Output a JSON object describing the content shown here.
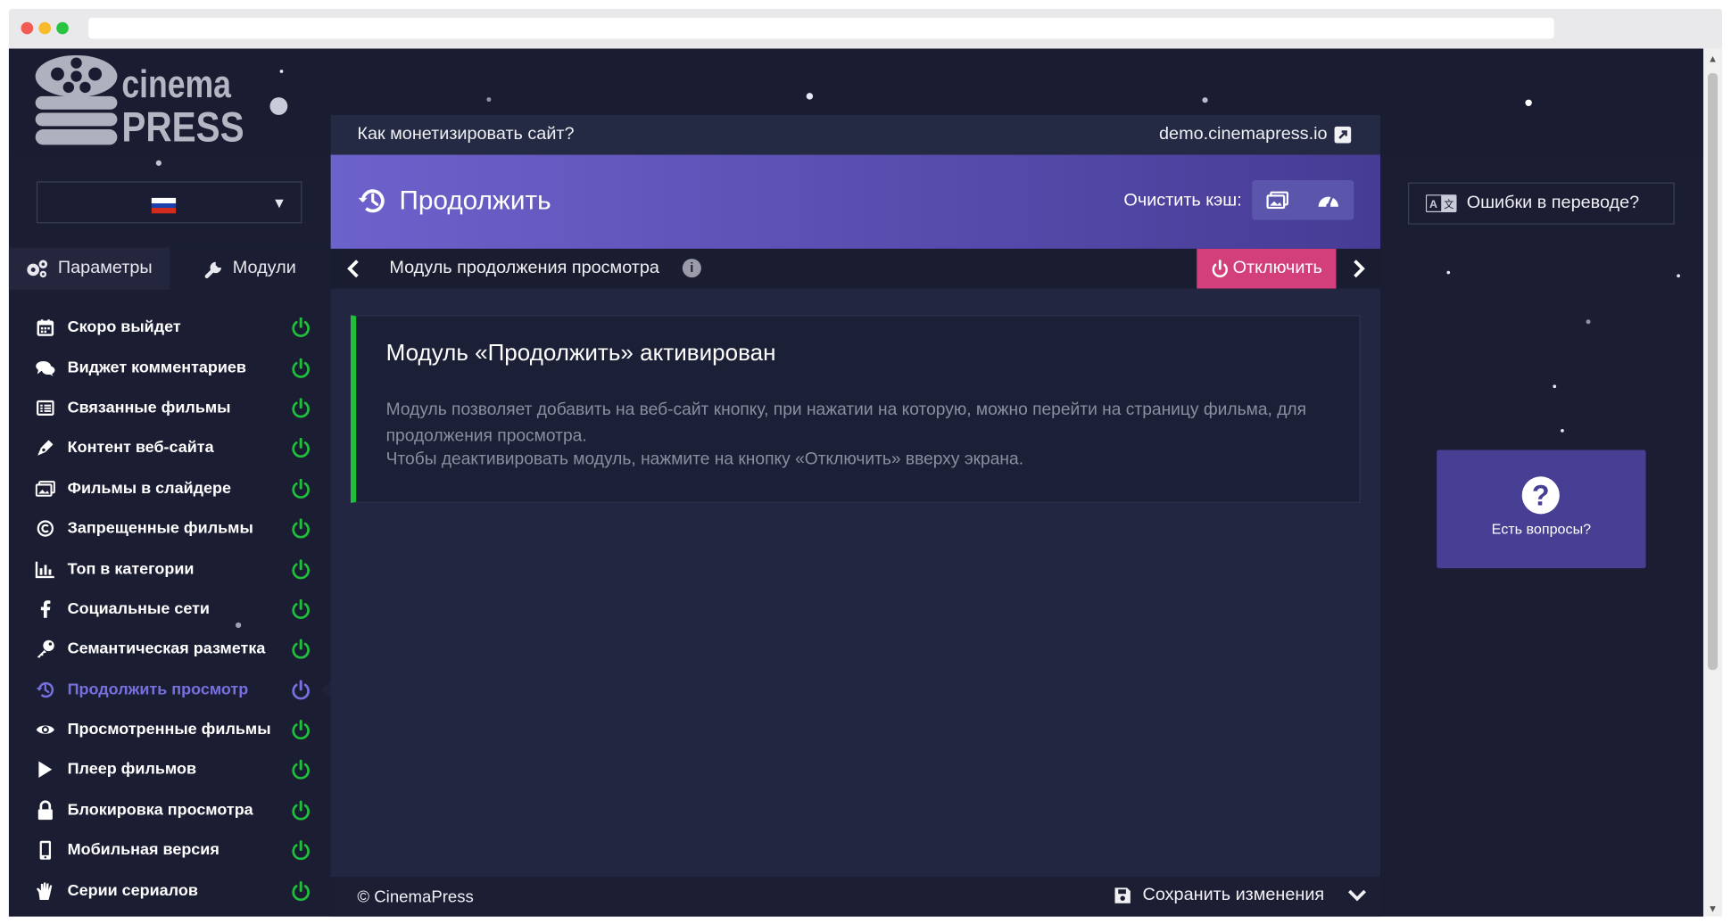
{
  "brand": {
    "line1": "cinema",
    "line2": "PRESS"
  },
  "language": {
    "flag": "ru-flag",
    "colors": [
      "#ffffff",
      "#1c3fae",
      "#d52b1e"
    ]
  },
  "tabs": {
    "params": "Параметры",
    "modules": "Модули"
  },
  "menu": [
    {
      "label": "Скоро выйдет",
      "icon": "calendar-icon"
    },
    {
      "label": "Виджет комментариев",
      "icon": "comments-icon"
    },
    {
      "label": "Связанные фильмы",
      "icon": "list-icon"
    },
    {
      "label": "Контент веб-сайта",
      "icon": "pen-icon"
    },
    {
      "label": "Фильмы в слайдере",
      "icon": "images-icon"
    },
    {
      "label": "Запрещенные фильмы",
      "icon": "copyright-icon"
    },
    {
      "label": "Топ в категории",
      "icon": "chart-icon"
    },
    {
      "label": "Социальные сети",
      "icon": "facebook-icon"
    },
    {
      "label": "Семантическая разметка",
      "icon": "key-icon"
    },
    {
      "label": "Продолжить просмотр",
      "icon": "history-icon",
      "active": true
    },
    {
      "label": "Просмотренные фильмы",
      "icon": "eye-icon"
    },
    {
      "label": "Плеер фильмов",
      "icon": "play-icon"
    },
    {
      "label": "Блокировка просмотра",
      "icon": "lock-icon"
    },
    {
      "label": "Мобильная версия",
      "icon": "mobile-icon"
    },
    {
      "label": "Серии сериалов",
      "icon": "hand-icon"
    }
  ],
  "topbar": {
    "monetize": "Как монетизировать сайт?",
    "site": "demo.cinemapress.io"
  },
  "header": {
    "title": "Продолжить",
    "cache_label": "Очистить кэш:"
  },
  "subbar": {
    "module": "Модуль продолжения просмотра",
    "off": "Отключить"
  },
  "notice": {
    "title": "Модуль «Продолжить» активирован",
    "text1": "Модуль позволяет добавить на веб-сайт кнопку, при нажатии на которую, можно перейти на страницу фильма, для продолжения просмотра.",
    "text2": "Чтобы деактивировать модуль, нажмите на кнопку «Отключить» вверху экрана."
  },
  "footer": {
    "copy": "© CinemaPress",
    "save": "Сохранить изменения"
  },
  "right": {
    "translation": "Ошибки в переводе?",
    "questions": "Есть вопросы?"
  },
  "colors": {
    "accent": "#7a6fe0",
    "danger": "#d23f7a",
    "success": "#1fbf3c",
    "bg": "#1b1e33"
  }
}
